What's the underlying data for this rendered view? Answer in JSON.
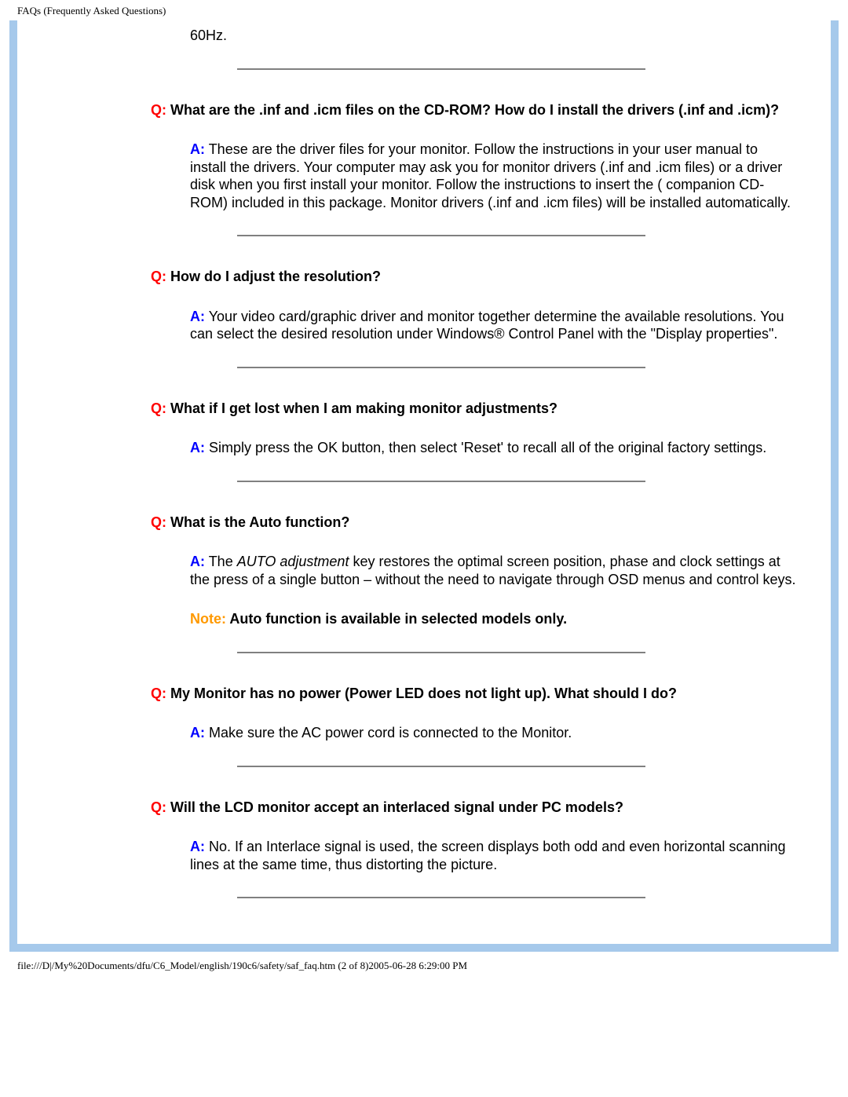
{
  "header": {
    "title": "FAQs (Frequently Asked Questions)"
  },
  "fragment_tail": "60Hz.",
  "faqs": [
    {
      "q": "What are the .inf and .icm files on the CD-ROM? How do I install the drivers (.inf and .icm)?",
      "a": "These are the driver files for your monitor. Follow the instructions in your user manual to install the drivers. Your computer may ask you for monitor drivers (.inf and .icm files) or a driver disk when you first install your monitor. Follow the instructions to insert the ( companion CD-ROM) included in this package. Monitor drivers (.inf and .icm files) will be installed automatically."
    },
    {
      "q": "How do I adjust the resolution?",
      "a": "Your video card/graphic driver and monitor together determine the available resolutions. You can select the desired resolution under Windows® Control Panel with the \"Display properties\"."
    },
    {
      "q": "What if I get lost when I am making monitor adjustments?",
      "a": "Simply press the OK button, then select 'Reset' to recall all of the original factory settings."
    },
    {
      "q": "What is the Auto function?",
      "a_pre": "The ",
      "a_italic": "AUTO adjustment",
      "a_post": " key restores the optimal screen position, phase and clock settings at the press of a single button – without the need to navigate through OSD menus and control keys.",
      "note_label": "Note: ",
      "note_text": "Auto function is available in selected models only."
    },
    {
      "q": "My Monitor has no power (Power LED does not light up). What should I do?",
      "a": "Make sure the AC power cord is connected to the Monitor."
    },
    {
      "q": "Will the LCD monitor accept an interlaced signal under PC models?",
      "a": "No. If an Interlace signal is used, the screen displays both odd and even horizontal scanning lines at the same time, thus distorting the picture."
    }
  ],
  "labels": {
    "q": "Q:",
    "a": "A:"
  },
  "footer": {
    "path": "file:///D|/My%20Documents/dfu/C6_Model/english/190c6/safety/saf_faq.htm (2 of 8)2005-06-28 6:29:00 PM"
  }
}
